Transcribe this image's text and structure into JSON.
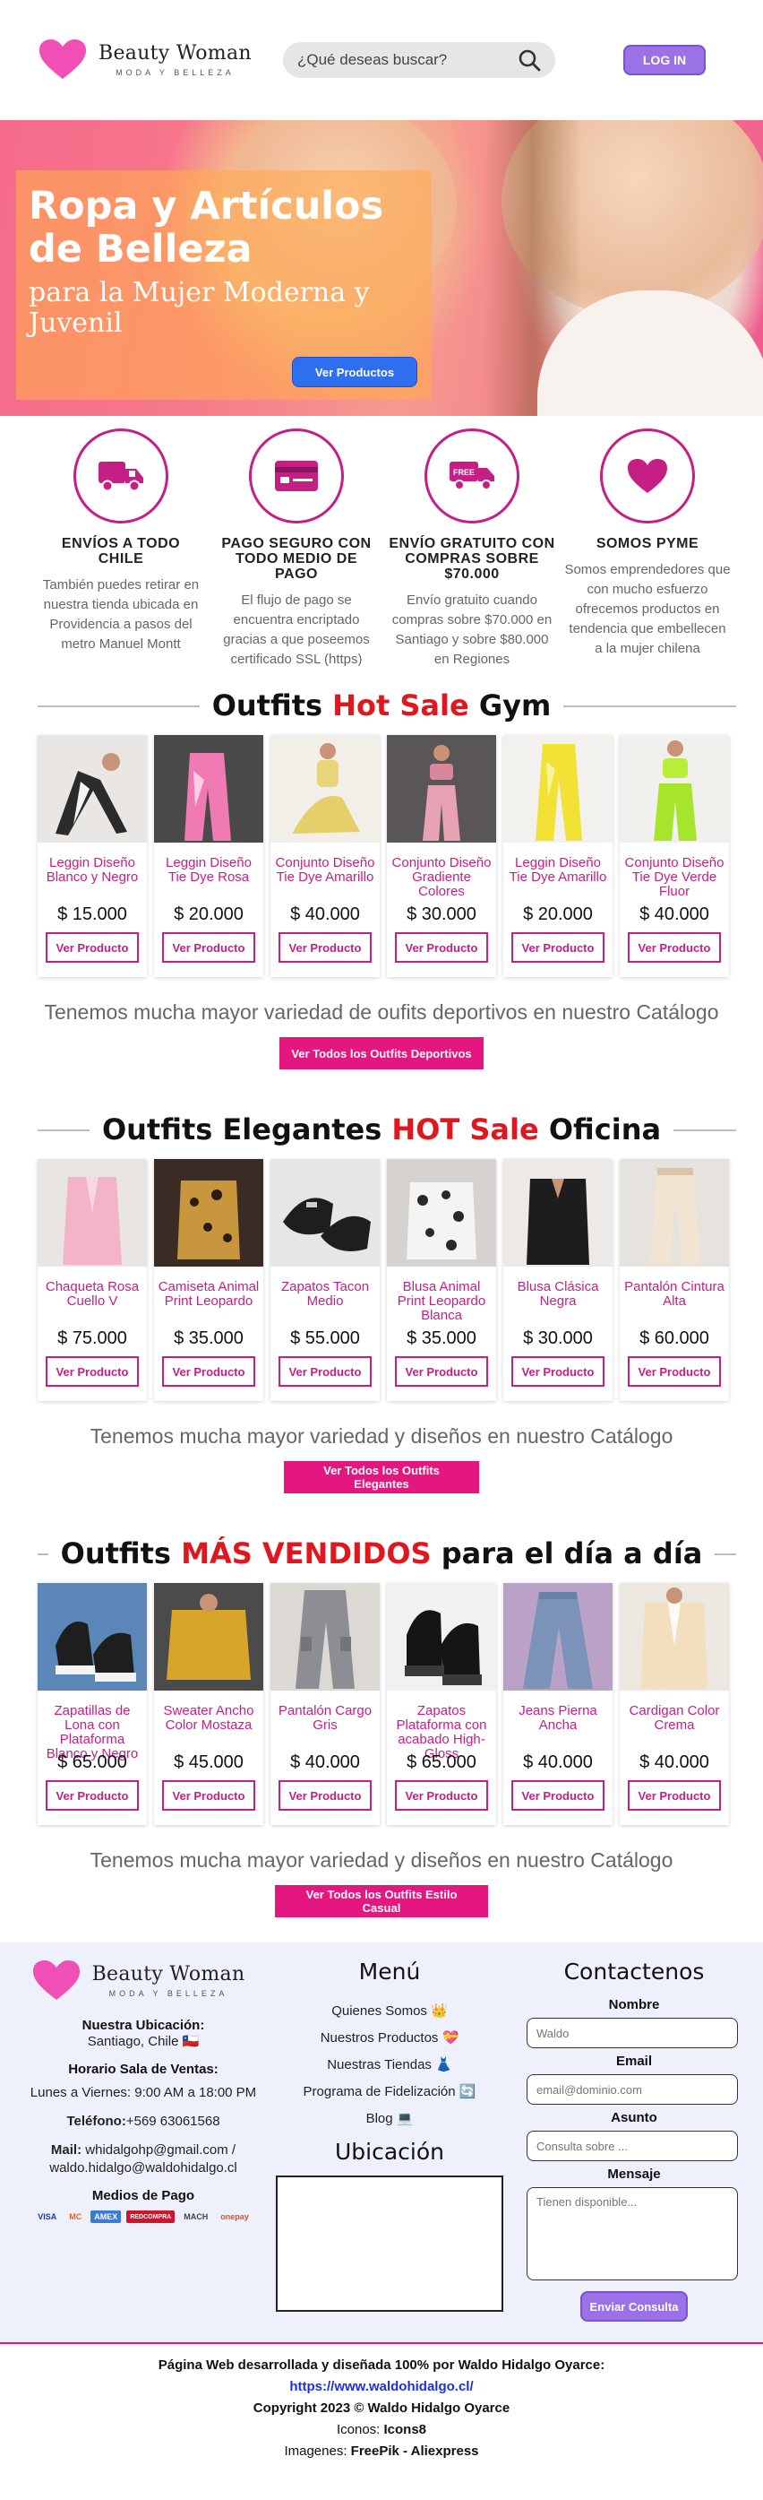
{
  "brand": {
    "name": "Beauty Woman",
    "tagline": "MODA Y BELLEZA"
  },
  "header": {
    "search_placeholder": "¿Qué deseas buscar?",
    "login_label": "LOG IN"
  },
  "hero": {
    "title": "Ropa y Artículos de Belleza",
    "subtitle": "para la Mujer Moderna y Juvenil",
    "cta_label": "Ver Productos"
  },
  "features": [
    {
      "icon": "delivery-truck-icon",
      "title": "ENVÍOS A TODO CHILE",
      "text": "También puedes retirar en nuestra tienda ubicada en Providencia a pasos del metro Manuel Montt"
    },
    {
      "icon": "credit-card-icon",
      "title": "PAGO SEGURO CON TODO MEDIO DE PAGO",
      "text": "El flujo de pago se encuentra encriptado gracias a que poseemos certificado SSL (https)"
    },
    {
      "icon": "free-shipping-icon",
      "title": "ENVÍO GRATUITO CON COMPRAS SOBRE $70.000",
      "text": "Envío gratuito cuando compras sobre $70.000 en Santiago y sobre $80.000 en Regiones"
    },
    {
      "icon": "heart-icon",
      "title": "SOMOS PYME",
      "text": "Somos emprendedores que con mucho esfuerzo ofrecemos productos en tendencia que embellecen a la mujer chilena"
    }
  ],
  "sections": [
    {
      "title_pre": "Outfits ",
      "title_hot": "Hot Sale",
      "title_post": " Gym",
      "products": [
        {
          "name": "Leggin Diseño Blanco y Negro",
          "price": "$ 15.000",
          "button": "Ver Producto"
        },
        {
          "name": "Leggin Diseño Tie Dye Rosa",
          "price": "$ 20.000",
          "button": "Ver Producto"
        },
        {
          "name": "Conjunto Diseño Tie Dye Amarillo",
          "price": "$ 40.000",
          "button": "Ver Producto"
        },
        {
          "name": "Conjunto Diseño Gradiente Colores",
          "price": "$ 30.000",
          "button": "Ver Producto"
        },
        {
          "name": "Leggin Diseño Tie Dye Amarillo",
          "price": "$ 20.000",
          "button": "Ver Producto"
        },
        {
          "name": "Conjunto Diseño Tie Dye Verde Fluor",
          "price": "$ 40.000",
          "button": "Ver Producto"
        }
      ],
      "more_text": "Tenemos mucha mayor variedad de oufits deportivos en nuestro Catálogo",
      "more_button": "Ver Todos los Outfits Deportivos"
    },
    {
      "title_pre": "Outfits Elegantes ",
      "title_hot": "HOT Sale",
      "title_post": " Oficina",
      "products": [
        {
          "name": "Chaqueta Rosa Cuello V",
          "price": "$ 75.000",
          "button": "Ver Producto"
        },
        {
          "name": "Camiseta Animal Print Leopardo",
          "price": "$ 35.000",
          "button": "Ver Producto"
        },
        {
          "name": "Zapatos Tacon Medio",
          "price": "$ 55.000",
          "button": "Ver Producto"
        },
        {
          "name": "Blusa Animal Print Leopardo Blanca",
          "price": "$ 35.000",
          "button": "Ver Producto"
        },
        {
          "name": "Blusa Clásica Negra",
          "price": "$ 30.000",
          "button": "Ver Producto"
        },
        {
          "name": "Pantalón Cintura Alta",
          "price": "$ 60.000",
          "button": "Ver Producto"
        }
      ],
      "more_text": "Tenemos mucha mayor variedad y diseños en nuestro Catálogo",
      "more_button": "Ver Todos los Outfits Elegantes"
    },
    {
      "title_pre": "Outfits ",
      "title_hot": "MÁS VENDIDOS",
      "title_post": " para el día a día",
      "products": [
        {
          "name": "Zapatillas de Lona con Plataforma Blanco y Negro",
          "price": "$ 65.000",
          "button": "Ver Producto"
        },
        {
          "name": "Sweater Ancho Color Mostaza",
          "price": "$ 45.000",
          "button": "Ver Producto"
        },
        {
          "name": "Pantalón Cargo Gris",
          "price": "$ 40.000",
          "button": "Ver Producto"
        },
        {
          "name": "Zapatos Plataforma con acabado High-Gloss",
          "price": "$ 65.000",
          "button": "Ver Producto"
        },
        {
          "name": "Jeans Pierna Ancha",
          "price": "$ 40.000",
          "button": "Ver Producto"
        },
        {
          "name": "Cardigan Color Crema",
          "price": "$ 40.000",
          "button": "Ver Producto"
        }
      ],
      "more_text": "Tenemos mucha mayor variedad y diseños en nuestro Catálogo",
      "more_button": "Ver Todos los Outfits Estilo Casual"
    }
  ],
  "footer": {
    "location_label": "Nuestra Ubicación:",
    "location_value": "Santiago, Chile 🇨🇱",
    "hours_label": "Horario Sala de Ventas:",
    "hours_value": "Lunes a Viernes: 9:00 AM a 18:00 PM",
    "phone_label": "Teléfono:",
    "phone_value": "+569 63061568",
    "mail_label": "Mail:",
    "mail_value": "whidalgohp@gmail.com / waldo.hidalgo@waldohidalgo.cl",
    "payment_label": "Medios de Pago",
    "payment_methods": [
      "VISA",
      "MC",
      "AMEX",
      "REDCOMPRA",
      "MACH",
      "onepay"
    ],
    "menu_title": "Menú",
    "menu_items": [
      "Quienes Somos 👑",
      "Nuestros Productos 💝",
      "Nuestras Tiendas 👗",
      "Programa de Fidelización 🔄",
      "Blog 💻"
    ],
    "map_title": "Ubicación",
    "contact_title": "Contactenos",
    "name_label": "Nombre",
    "name_placeholder": "Waldo",
    "email_label": "Email",
    "email_placeholder": "email@dominio.com",
    "subject_label": "Asunto",
    "subject_placeholder": "Consulta sobre ...",
    "message_label": "Mensaje",
    "message_placeholder": "Tienen disponible...",
    "send_label": "Enviar Consulta"
  },
  "credits": {
    "line1": "Página Web desarrollada y diseñada 100% por Waldo Hidalgo Oyarce:",
    "link": "https://www.waldohidalgo.cl/",
    "copyright": "Copyright 2023 © Waldo Hidalgo Oyarce",
    "icons_label": "Iconos: ",
    "icons_value": "Icons8",
    "images_label": "Imagenes: ",
    "images_value": "FreePik - Aliexpress"
  },
  "colors": {
    "brand_pink": "#c51f86",
    "hot_red": "#e0171f",
    "cta_magenta": "#e3177f",
    "login_purple": "#9a72e6",
    "hero_button_blue": "#2e6ff0"
  }
}
